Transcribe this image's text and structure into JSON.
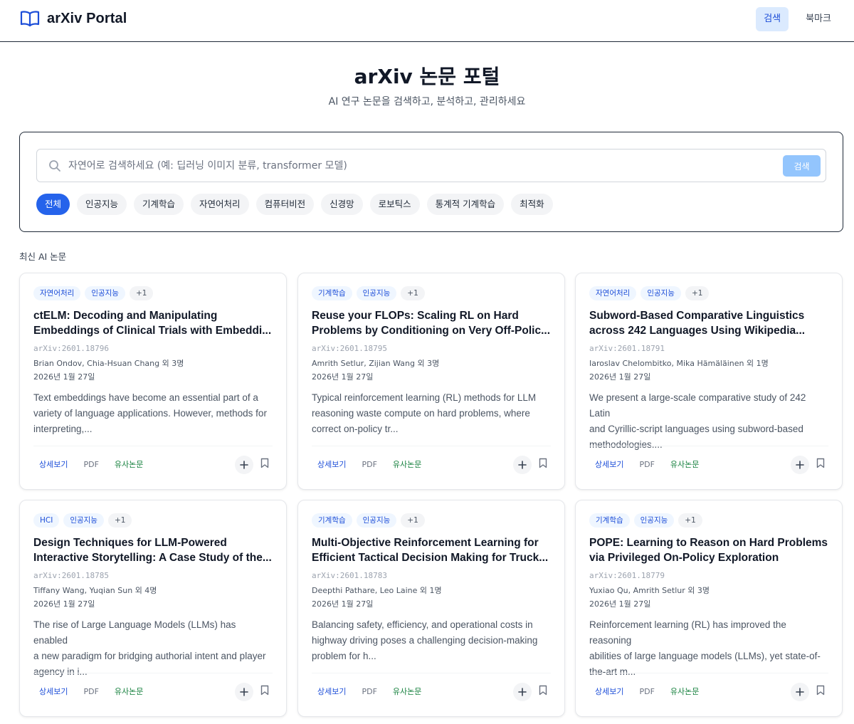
{
  "header": {
    "brand": "arXiv Portal",
    "nav": [
      {
        "label": "검색",
        "active": true
      },
      {
        "label": "북마크",
        "active": false
      }
    ]
  },
  "hero": {
    "title": "arXiv 논문 포털",
    "subtitle": "AI 연구 논문을 검색하고, 분석하고, 관리하세요"
  },
  "search": {
    "placeholder": "자연어로 검색하세요 (예: 딥러닝 이미지 분류, transformer 모델)",
    "value": "",
    "button": "검색",
    "categories": [
      "전체",
      "인공지능",
      "기계학습",
      "자연어처리",
      "컴퓨터비전",
      "신경망",
      "로보틱스",
      "통계적 기계학습",
      "최적화"
    ],
    "active_category": "전체"
  },
  "section_label": "최신 AI 논문",
  "card_actions": {
    "detail": "상세보기",
    "pdf": "PDF",
    "similar": "유사논문"
  },
  "icons": {
    "brand": "book-open-icon",
    "search": "search-icon",
    "add": "plus-icon",
    "bookmark": "bookmark-icon"
  },
  "colors": {
    "accent": "#2563eb",
    "accent_light": "#dbeafe",
    "similar": "#15803d"
  },
  "papers": [
    {
      "tags": [
        "자연어처리",
        "인공지능",
        "+1"
      ],
      "title_lines": [
        "ctELM: Decoding and Manipulating",
        "Embeddings of Clinical Trials with Embeddi..."
      ],
      "id": "arXiv:2601.18796",
      "authors": "Brian Ondov, Chia-Hsuan Chang 외 3명",
      "date": "2026년 1월 27일",
      "abstract_lines": [
        "Text embeddings have become an essential part of a",
        "variety of language applications. However, methods for",
        "interpreting,..."
      ]
    },
    {
      "tags": [
        "기계학습",
        "인공지능",
        "+1"
      ],
      "title_lines": [
        "Reuse your FLOPs: Scaling RL on Hard",
        "Problems by Conditioning on Very Off-Polic..."
      ],
      "id": "arXiv:2601.18795",
      "authors": "Amrith Setlur, Zijian Wang 외 3명",
      "date": "2026년 1월 27일",
      "abstract_lines": [
        "Typical reinforcement learning (RL) methods for LLM",
        "reasoning waste compute on hard problems, where",
        "correct on-policy tr..."
      ]
    },
    {
      "tags": [
        "자연어처리",
        "인공지능",
        "+1"
      ],
      "title_lines": [
        "Subword-Based Comparative Linguistics",
        "across 242 Languages Using Wikipedia..."
      ],
      "id": "arXiv:2601.18791",
      "authors": "Iaroslav Chelombitko, Mika Hämäläinen 외 1명",
      "date": "2026년 1월 27일",
      "abstract_lines": [
        "We present a large-scale comparative study of 242 Latin",
        "and Cyrillic-script languages using subword-based",
        "methodologies...."
      ]
    },
    {
      "tags": [
        "HCI",
        "인공지능",
        "+1"
      ],
      "title_lines": [
        "Design Techniques for LLM-Powered",
        "Interactive Storytelling: A Case Study of the..."
      ],
      "id": "arXiv:2601.18785",
      "authors": "Tiffany Wang, Yuqian Sun 외 4명",
      "date": "2026년 1월 27일",
      "abstract_lines": [
        "The rise of Large Language Models (LLMs) has enabled",
        "a new paradigm for bridging authorial intent and player",
        "agency in i..."
      ]
    },
    {
      "tags": [
        "기계학습",
        "인공지능",
        "+1"
      ],
      "title_lines": [
        "Multi-Objective Reinforcement Learning for",
        "Efficient Tactical Decision Making for Truck..."
      ],
      "id": "arXiv:2601.18783",
      "authors": "Deepthi Pathare, Leo Laine 외 1명",
      "date": "2026년 1월 27일",
      "abstract_lines": [
        "Balancing safety, efficiency, and operational costs in",
        "highway driving poses a challenging decision-making",
        "problem for h..."
      ]
    },
    {
      "tags": [
        "기계학습",
        "인공지능",
        "+1"
      ],
      "title_lines": [
        "POPE: Learning to Reason on Hard Problems",
        "via Privileged On-Policy Exploration"
      ],
      "id": "arXiv:2601.18779",
      "authors": "Yuxiao Qu, Amrith Setlur 외 3명",
      "date": "2026년 1월 27일",
      "abstract_lines": [
        "Reinforcement learning (RL) has improved the reasoning",
        "abilities of large language models (LLMs), yet state-of-",
        "the-art m..."
      ]
    }
  ]
}
